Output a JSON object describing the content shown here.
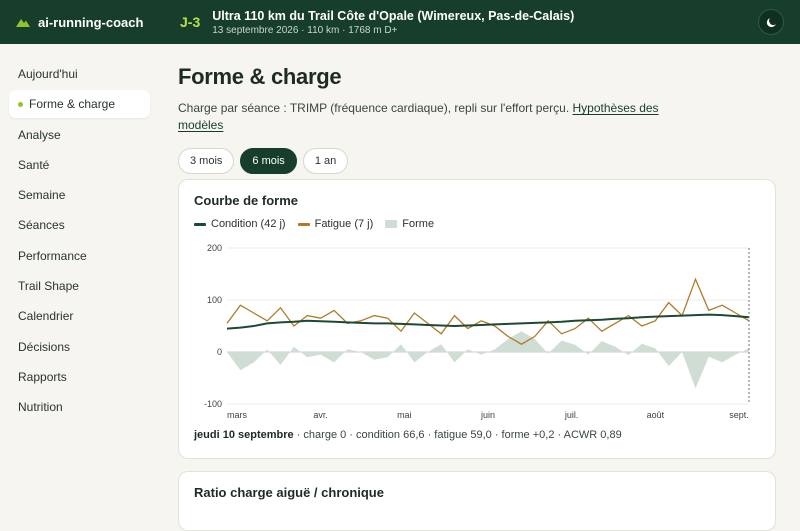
{
  "app": {
    "name": "ai-running-coach"
  },
  "race": {
    "countdown": "J-3",
    "title": "Ultra 110 km du Trail Côte d'Opale (Wimereux, Pas-de-Calais)",
    "meta": "13 septembre 2026 · 110 km · 1768 m D+"
  },
  "sidebar": {
    "items": [
      {
        "label": "Aujourd'hui",
        "active": false
      },
      {
        "label": "Forme & charge",
        "active": true
      },
      {
        "label": "Analyse",
        "active": false
      },
      {
        "label": "Santé",
        "active": false
      },
      {
        "label": "Semaine",
        "active": false
      },
      {
        "label": "Séances",
        "active": false
      },
      {
        "label": "Performance",
        "active": false
      },
      {
        "label": "Trail Shape",
        "active": false
      },
      {
        "label": "Calendrier",
        "active": false
      },
      {
        "label": "Décisions",
        "active": false
      },
      {
        "label": "Rapports",
        "active": false
      },
      {
        "label": "Nutrition",
        "active": false
      }
    ]
  },
  "page": {
    "title": "Forme & charge",
    "description": "Charge par séance : TRIMP (fréquence cardiaque), repli sur l'effort perçu.",
    "models_link": "Hypothèses des modèles"
  },
  "periods": [
    {
      "label": "3 mois",
      "active": false
    },
    {
      "label": "6 mois",
      "active": true
    },
    {
      "label": "1 an",
      "active": false
    }
  ],
  "fitness_card": {
    "title": "Courbe de forme",
    "legend": [
      {
        "label": "Condition (42 j)",
        "color": "#1c4a33"
      },
      {
        "label": "Fatigue (7 j)",
        "color": "#b07a2a"
      },
      {
        "label": "Forme",
        "color": "#cfddd5"
      }
    ],
    "readout": {
      "date": "jeudi 10 septembre",
      "text": " · charge 0 · condition 66,6 · fatigue 59,0 · forme +0,2 · ACWR 0,89"
    }
  },
  "chart_data": {
    "type": "line",
    "ylim": [
      -100,
      200
    ],
    "y_ticks": [
      "200",
      "100",
      "0",
      "-100"
    ],
    "x_ticks": [
      "mars",
      "avr.",
      "mai",
      "juin",
      "juil.",
      "août",
      "sept."
    ],
    "series": [
      {
        "name": "Condition (42 j)",
        "values": [
          45,
          47,
          50,
          55,
          57,
          58,
          60,
          59,
          58,
          57,
          56,
          55,
          55,
          54,
          53,
          52,
          51,
          50,
          51,
          52,
          53,
          54,
          55,
          56,
          57,
          58,
          60,
          61,
          62,
          64,
          65,
          67,
          68,
          69,
          70,
          71,
          72,
          71,
          69,
          67
        ]
      },
      {
        "name": "Fatigue (7 j)",
        "values": [
          55,
          90,
          75,
          60,
          85,
          50,
          70,
          65,
          80,
          55,
          60,
          70,
          65,
          40,
          75,
          55,
          35,
          70,
          45,
          60,
          50,
          30,
          15,
          30,
          60,
          35,
          45,
          65,
          40,
          55,
          70,
          50,
          60,
          95,
          70,
          140,
          80,
          90,
          75,
          60
        ]
      },
      {
        "name": "Forme",
        "values": [
          0,
          -35,
          -20,
          5,
          -25,
          10,
          -10,
          -5,
          -20,
          5,
          0,
          -15,
          -10,
          15,
          -20,
          0,
          15,
          -20,
          5,
          -5,
          5,
          25,
          40,
          25,
          -3,
          22,
          14,
          -5,
          21,
          10,
          -6,
          16,
          7,
          -27,
          0,
          -70,
          -9,
          -20,
          -5,
          7
        ]
      }
    ]
  },
  "ratio_card": {
    "title": "Ratio charge aiguë / chronique"
  }
}
